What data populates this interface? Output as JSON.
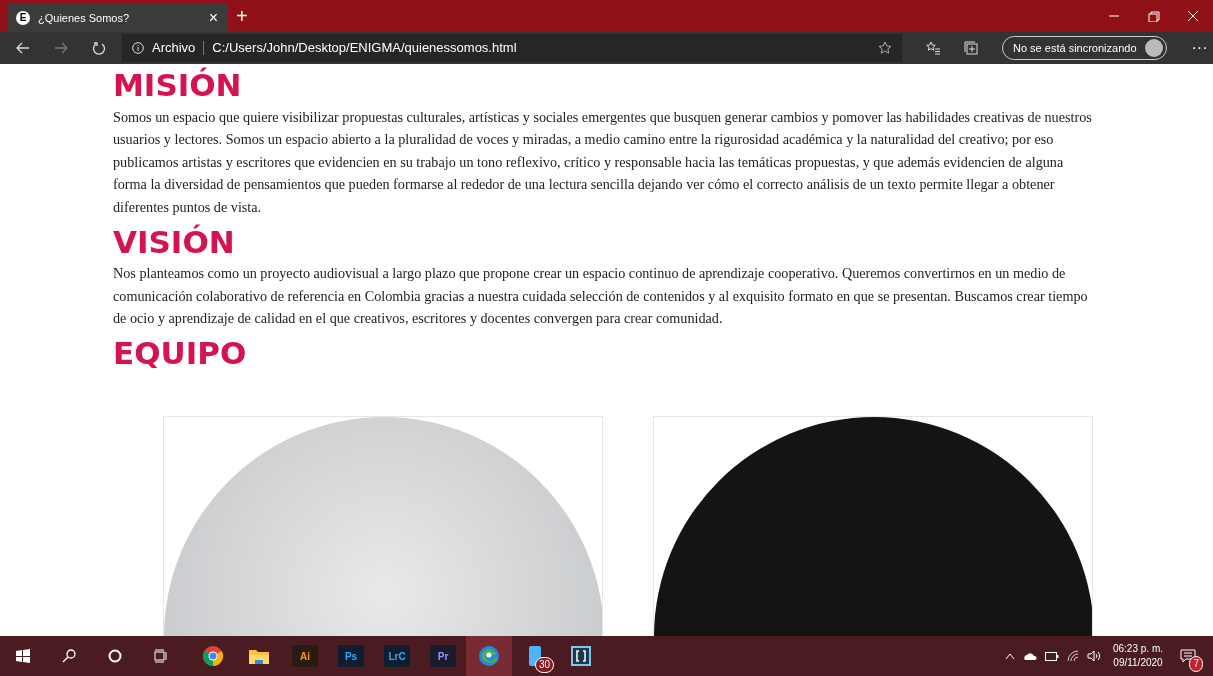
{
  "browser": {
    "tab": {
      "favicon": "E",
      "title": "¿Quienes Somos?",
      "close": "×",
      "selected": true
    },
    "new_tab": "+",
    "address": {
      "security": "Archivo",
      "url": "C:/Users/John/Desktop/ENIGMA/quienessomos.html"
    },
    "sync_button": "No se está sincronizando",
    "more": "···"
  },
  "sections": [
    {
      "heading": "MISIÓN",
      "text": "Somos un espacio que quiere visibilizar propuestas culturales, artísticas y sociales emergentes que busquen generar cambios y pomover las habilidades creativas de nuestros usuarios y lectores. Somos un espacio abierto a la pluralidad de voces y miradas, a medio camino entre la rigurosidad académica y la naturalidad del creativo; por eso publicamos artistas y escritores que evidencien en su trabajo un tono reflexivo, crítico y responsable hacia las temáticas propuestas, y que además evidencien de alguna forma la diversidad de pensamientos que pueden formarse al rededor de una lectura sencilla dejando ver cómo el correcto análisis de un texto permite llegar a obtener diferentes puntos de vista."
    },
    {
      "heading": "VISIÓN",
      "text": "Nos planteamos como un proyecto audiovisual a largo plazo que propone crear un espacio continuo de aprendizaje cooperativo. Queremos convertirnos en un medio de comunicación colaborativo de referencia en Colombia gracias a nuestra cuidada selección de contenidos y al exquisito formato en que se presentan. Buscamos crear tiempo de ocio y aprendizaje de calidad en el que creativos, escritores y docentes convergen para crear comunidad."
    },
    {
      "heading": "EQUIPO"
    }
  ],
  "team": [
    {
      "kind": "light"
    },
    {
      "kind": "dark"
    }
  ],
  "taskbar": {
    "apps": [
      {
        "kind": "chrome",
        "selected": false
      },
      {
        "kind": "folder",
        "selected": false
      },
      {
        "kind": "tile",
        "label": "Ai",
        "color": "#ff9a00",
        "selected": false
      },
      {
        "kind": "tile",
        "label": "Ps",
        "color": "#31a8ff",
        "selected": false
      },
      {
        "kind": "tile",
        "label": "LrC",
        "color": "#31a8ff",
        "selected": false
      },
      {
        "kind": "tile",
        "label": "Pr",
        "color": "#9999ff",
        "selected": false
      },
      {
        "kind": "edge",
        "selected": true
      },
      {
        "kind": "phone",
        "badge": "30",
        "selected": false
      },
      {
        "kind": "bracket",
        "selected": false
      }
    ],
    "time": "06:23 p. m.",
    "date": "09/11/2020",
    "notifications": "7"
  }
}
